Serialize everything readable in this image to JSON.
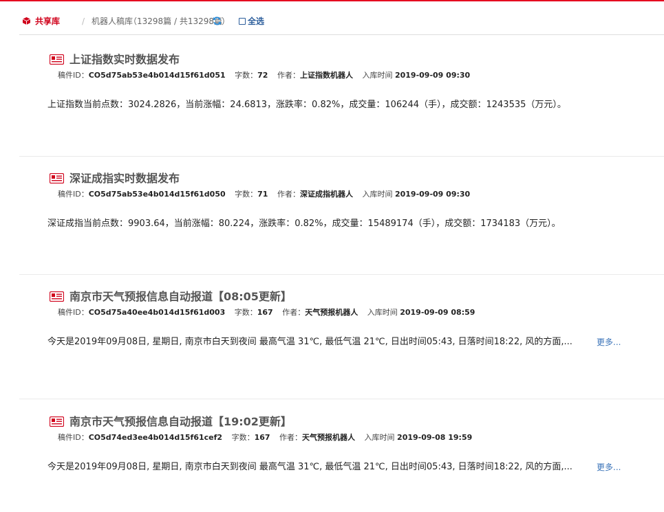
{
  "header": {
    "share_label": "共享库",
    "separator": "/",
    "crumb": "机器人稿库",
    "count_text": "（13298篇 / 共13298篇",
    "count_end": "）",
    "select_all": "全选"
  },
  "labels": {
    "id": "稿件ID：",
    "words": "字数：",
    "author": "作者：",
    "time": "入库时间"
  },
  "articles": [
    {
      "title": "上证指数实时数据发布",
      "id": "CO5d75ab53e4b014d15f61d051",
      "words": "72",
      "author": "上证指数机器人",
      "time": "2019-09-09 09:30",
      "body": "上证指数当前点数：3024.2826，当前涨幅：24.6813，涨跌率：0.82%，成交量：106244（手），成交额：1243535（万元）。",
      "more": ""
    },
    {
      "title": "深证成指实时数据发布",
      "id": "CO5d75ab53e4b014d15f61d050",
      "words": "71",
      "author": "深证成指机器人",
      "time": "2019-09-09 09:30",
      "body": "深证成指当前点数：9903.64，当前涨幅：80.224，涨跌率：0.82%，成交量：15489174（手），成交额：1734183（万元）。",
      "more": ""
    },
    {
      "title": "南京市天气预报信息自动报道【08:05更新】",
      "id": "CO5d75a40ee4b014d15f61d003",
      "words": "167",
      "author": "天气预报机器人",
      "time": "2019-09-09 08:59",
      "body": "今天是2019年09月08日, 星期日, 南京市白天到夜间 最高气温 31℃, 最低气温 21℃, 日出时间05:43, 日落时间18:22, 风的方面,...",
      "more": "更多..."
    },
    {
      "title": "南京市天气预报信息自动报道【19:02更新】",
      "id": "CO5d74ed3ee4b014d15f61cef2",
      "words": "167",
      "author": "天气预报机器人",
      "time": "2019-09-08 19:59",
      "body": "今天是2019年09月08日, 星期日, 南京市白天到夜间 最高气温 31℃, 最低气温 21℃, 日出时间05:43, 日落时间18:22, 风的方面,...",
      "more": "更多..."
    }
  ],
  "colors": {
    "accent_red": "#e5001f",
    "link_blue": "#3a73b8",
    "title_gray": "#555555"
  },
  "icons": {
    "share": "cube-icon",
    "refresh": "refresh-icon",
    "doc": "document-icon"
  }
}
